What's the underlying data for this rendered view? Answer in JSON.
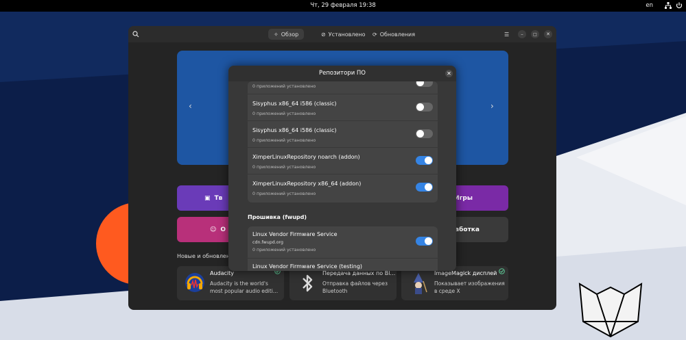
{
  "topbar": {
    "clock": "Чт, 29 февраля  19:38",
    "lang": "en",
    "network_icon": "network-icon",
    "power_icon": "power-icon"
  },
  "header": {
    "tabs": [
      {
        "label": "Обзор",
        "icon": "explore-icon",
        "active": true
      },
      {
        "label": "Установлено",
        "icon": "check-circle-icon",
        "active": false
      },
      {
        "label": "Обновления",
        "icon": "refresh-icon",
        "active": false
      }
    ]
  },
  "main": {
    "categories": [
      {
        "label": "Тв",
        "color": "#6a3bb8",
        "icon": "create-icon"
      },
      {
        "label": "Игры",
        "color": "#7a2aa6",
        "icon": "games-icon"
      },
      {
        "label": "О",
        "color": "#b8307a",
        "icon": "emoji-icon"
      },
      {
        "label": "работка",
        "color": "#3a3a3a",
        "icon": "develop-icon"
      }
    ],
    "section_label": "Новые и обновленн",
    "cards": [
      {
        "title": "Audacity",
        "desc": "Audacity is the world's most popular audio editi…",
        "icon": "audacity-icon"
      },
      {
        "title": "Передача данных по Bl…",
        "desc": "Отправка файлов через Bluetooth",
        "icon": "bluetooth-icon"
      },
      {
        "title": "ImageMagick дисплей",
        "desc": "Показывает изображения в среде X",
        "icon": "imagemagick-icon"
      }
    ]
  },
  "dialog": {
    "title": "Репозитори ПО",
    "close": "✕",
    "rows": [
      {
        "name": "",
        "sub": "0 приложений установлено",
        "enabled": false
      },
      {
        "name": "Sisyphus x86_64 i586 (classic)",
        "sub": "0 приложений установлено",
        "enabled": false
      },
      {
        "name": "Sisyphus x86_64 i586 (classic)",
        "sub": "0 приложений установлено",
        "enabled": false
      },
      {
        "name": "XimperLinuxRepository noarch (addon)",
        "sub": "0 приложений установлено",
        "enabled": true
      },
      {
        "name": "XimperLinuxRepository x86_64 (addon)",
        "sub": "0 приложений установлено",
        "enabled": true
      }
    ],
    "group": "Прошивка (fwupd)",
    "fw_rows": [
      {
        "name": "Linux Vendor Firmware Service",
        "url": "cdn.fwupd.org",
        "sub": "0 приложений установлено",
        "enabled": true
      },
      {
        "name": "Linux Vendor Firmware Service (testing)",
        "url": "",
        "sub": "",
        "enabled": false
      }
    ]
  },
  "colors": {
    "accent": "#3584e4",
    "banner": "#1e56a3"
  }
}
